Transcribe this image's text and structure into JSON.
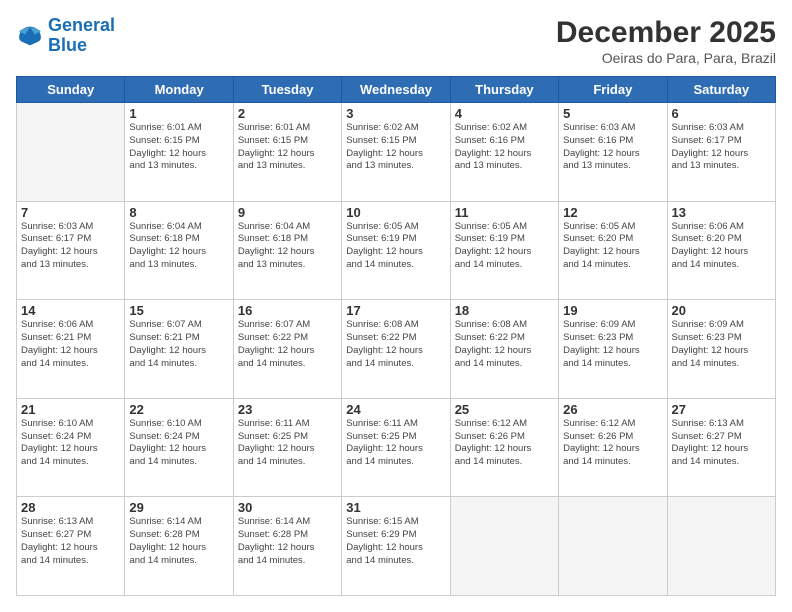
{
  "logo": {
    "line1": "General",
    "line2": "Blue"
  },
  "title": "December 2025",
  "location": "Oeiras do Para, Para, Brazil",
  "days_header": [
    "Sunday",
    "Monday",
    "Tuesday",
    "Wednesday",
    "Thursday",
    "Friday",
    "Saturday"
  ],
  "weeks": [
    [
      {
        "num": "",
        "info": ""
      },
      {
        "num": "1",
        "info": "Sunrise: 6:01 AM\nSunset: 6:15 PM\nDaylight: 12 hours\nand 13 minutes."
      },
      {
        "num": "2",
        "info": "Sunrise: 6:01 AM\nSunset: 6:15 PM\nDaylight: 12 hours\nand 13 minutes."
      },
      {
        "num": "3",
        "info": "Sunrise: 6:02 AM\nSunset: 6:15 PM\nDaylight: 12 hours\nand 13 minutes."
      },
      {
        "num": "4",
        "info": "Sunrise: 6:02 AM\nSunset: 6:16 PM\nDaylight: 12 hours\nand 13 minutes."
      },
      {
        "num": "5",
        "info": "Sunrise: 6:03 AM\nSunset: 6:16 PM\nDaylight: 12 hours\nand 13 minutes."
      },
      {
        "num": "6",
        "info": "Sunrise: 6:03 AM\nSunset: 6:17 PM\nDaylight: 12 hours\nand 13 minutes."
      }
    ],
    [
      {
        "num": "7",
        "info": "Sunrise: 6:03 AM\nSunset: 6:17 PM\nDaylight: 12 hours\nand 13 minutes."
      },
      {
        "num": "8",
        "info": "Sunrise: 6:04 AM\nSunset: 6:18 PM\nDaylight: 12 hours\nand 13 minutes."
      },
      {
        "num": "9",
        "info": "Sunrise: 6:04 AM\nSunset: 6:18 PM\nDaylight: 12 hours\nand 13 minutes."
      },
      {
        "num": "10",
        "info": "Sunrise: 6:05 AM\nSunset: 6:19 PM\nDaylight: 12 hours\nand 14 minutes."
      },
      {
        "num": "11",
        "info": "Sunrise: 6:05 AM\nSunset: 6:19 PM\nDaylight: 12 hours\nand 14 minutes."
      },
      {
        "num": "12",
        "info": "Sunrise: 6:05 AM\nSunset: 6:20 PM\nDaylight: 12 hours\nand 14 minutes."
      },
      {
        "num": "13",
        "info": "Sunrise: 6:06 AM\nSunset: 6:20 PM\nDaylight: 12 hours\nand 14 minutes."
      }
    ],
    [
      {
        "num": "14",
        "info": "Sunrise: 6:06 AM\nSunset: 6:21 PM\nDaylight: 12 hours\nand 14 minutes."
      },
      {
        "num": "15",
        "info": "Sunrise: 6:07 AM\nSunset: 6:21 PM\nDaylight: 12 hours\nand 14 minutes."
      },
      {
        "num": "16",
        "info": "Sunrise: 6:07 AM\nSunset: 6:22 PM\nDaylight: 12 hours\nand 14 minutes."
      },
      {
        "num": "17",
        "info": "Sunrise: 6:08 AM\nSunset: 6:22 PM\nDaylight: 12 hours\nand 14 minutes."
      },
      {
        "num": "18",
        "info": "Sunrise: 6:08 AM\nSunset: 6:22 PM\nDaylight: 12 hours\nand 14 minutes."
      },
      {
        "num": "19",
        "info": "Sunrise: 6:09 AM\nSunset: 6:23 PM\nDaylight: 12 hours\nand 14 minutes."
      },
      {
        "num": "20",
        "info": "Sunrise: 6:09 AM\nSunset: 6:23 PM\nDaylight: 12 hours\nand 14 minutes."
      }
    ],
    [
      {
        "num": "21",
        "info": "Sunrise: 6:10 AM\nSunset: 6:24 PM\nDaylight: 12 hours\nand 14 minutes."
      },
      {
        "num": "22",
        "info": "Sunrise: 6:10 AM\nSunset: 6:24 PM\nDaylight: 12 hours\nand 14 minutes."
      },
      {
        "num": "23",
        "info": "Sunrise: 6:11 AM\nSunset: 6:25 PM\nDaylight: 12 hours\nand 14 minutes."
      },
      {
        "num": "24",
        "info": "Sunrise: 6:11 AM\nSunset: 6:25 PM\nDaylight: 12 hours\nand 14 minutes."
      },
      {
        "num": "25",
        "info": "Sunrise: 6:12 AM\nSunset: 6:26 PM\nDaylight: 12 hours\nand 14 minutes."
      },
      {
        "num": "26",
        "info": "Sunrise: 6:12 AM\nSunset: 6:26 PM\nDaylight: 12 hours\nand 14 minutes."
      },
      {
        "num": "27",
        "info": "Sunrise: 6:13 AM\nSunset: 6:27 PM\nDaylight: 12 hours\nand 14 minutes."
      }
    ],
    [
      {
        "num": "28",
        "info": "Sunrise: 6:13 AM\nSunset: 6:27 PM\nDaylight: 12 hours\nand 14 minutes."
      },
      {
        "num": "29",
        "info": "Sunrise: 6:14 AM\nSunset: 6:28 PM\nDaylight: 12 hours\nand 14 minutes."
      },
      {
        "num": "30",
        "info": "Sunrise: 6:14 AM\nSunset: 6:28 PM\nDaylight: 12 hours\nand 14 minutes."
      },
      {
        "num": "31",
        "info": "Sunrise: 6:15 AM\nSunset: 6:29 PM\nDaylight: 12 hours\nand 14 minutes."
      },
      {
        "num": "",
        "info": ""
      },
      {
        "num": "",
        "info": ""
      },
      {
        "num": "",
        "info": ""
      }
    ]
  ]
}
